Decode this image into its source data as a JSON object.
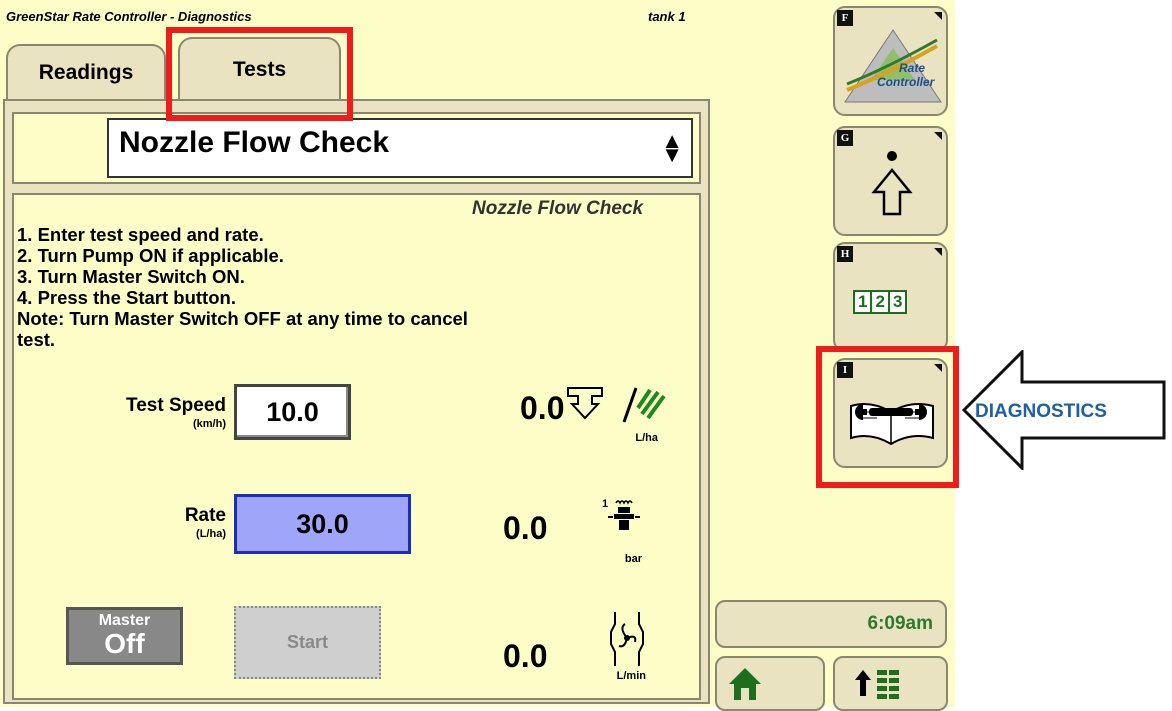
{
  "header": {
    "title": "GreenStar Rate Controller - Diagnostics",
    "tank": "tank 1"
  },
  "tabs": [
    {
      "label": "Readings"
    },
    {
      "label": "Tests"
    }
  ],
  "dropdown": {
    "selected": "Nozzle Flow Check"
  },
  "content": {
    "title": "Nozzle Flow Check",
    "instructions": [
      "1. Enter test speed and rate.",
      "2. Turn Pump ON if applicable.",
      "3. Turn Master Switch ON.",
      "4. Press the Start button.",
      "Note: Turn Master Switch OFF at any time to cancel",
      "test."
    ]
  },
  "test_speed": {
    "label": "Test Speed",
    "unit": "(km/h)",
    "value": "10.0"
  },
  "rate": {
    "label": "Rate",
    "unit": "(L/ha)",
    "value": "30.0"
  },
  "readouts": {
    "applied_rate": {
      "value": "0.0",
      "unit": "L/ha"
    },
    "pressure": {
      "value": "0.0",
      "unit": "bar",
      "section": "1"
    },
    "flow": {
      "value": "0.0",
      "unit": "L/min"
    }
  },
  "master": {
    "label": "Master",
    "state": "Off"
  },
  "start_button": {
    "label": "Start"
  },
  "sidebar": [
    {
      "key": "F",
      "icon": "rate-controller-icon",
      "text1": "Rate",
      "text2": "Controller"
    },
    {
      "key": "G",
      "icon": "up-arrow-dot-icon"
    },
    {
      "key": "H",
      "icon": "numbered-123-icon",
      "digits": [
        "1",
        "2",
        "3"
      ]
    },
    {
      "key": "I",
      "icon": "diagnostics-wrench-book-icon"
    }
  ],
  "time": "6:09am",
  "annotation": {
    "label": "DIAGNOSTICS"
  },
  "colors": {
    "background": "#fdfdc8",
    "panel": "#eae3c1",
    "rate_field": "#9fa5f8",
    "highlight": "#ef1c1c",
    "annotation_text": "#1f5fa6",
    "time_text": "#2d7a2d"
  }
}
